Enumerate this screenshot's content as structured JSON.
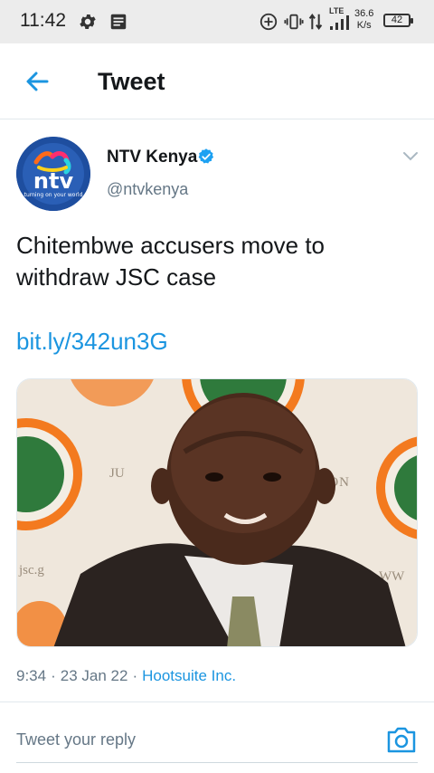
{
  "status_bar": {
    "time": "11:42",
    "network_type": "LTE",
    "speed_value": "36.6",
    "speed_unit": "K/s",
    "battery": "42",
    "icons": [
      "settings-gear-icon",
      "message-icon",
      "add-circle-icon",
      "vibrate-icon",
      "data-transfer-icon",
      "signal-icon",
      "battery-icon"
    ]
  },
  "header": {
    "title": "Tweet",
    "back_icon": "arrow-left-icon"
  },
  "tweet": {
    "author_name": "NTV Kenya",
    "author_handle": "@ntvkenya",
    "avatar_text": "ntv",
    "avatar_tagline": "turning on your world",
    "text": "Chitembwe accusers move to withdraw JSC case",
    "link": "bit.ly/342un3G",
    "media_sign_texts": [
      "JUDICIAL SERVICE COMMISSION",
      "jsc.go.ke",
      "www"
    ],
    "time": "9:34",
    "date": "23 Jan 22",
    "source": "Hootsuite Inc.",
    "separator": "·"
  },
  "reply": {
    "placeholder": "Tweet your reply"
  },
  "colors": {
    "accent": "#1b95e0",
    "verified": "#1da1f2",
    "text": "#14171a",
    "secondary": "#657786",
    "status_bar_bg": "#ececec"
  }
}
